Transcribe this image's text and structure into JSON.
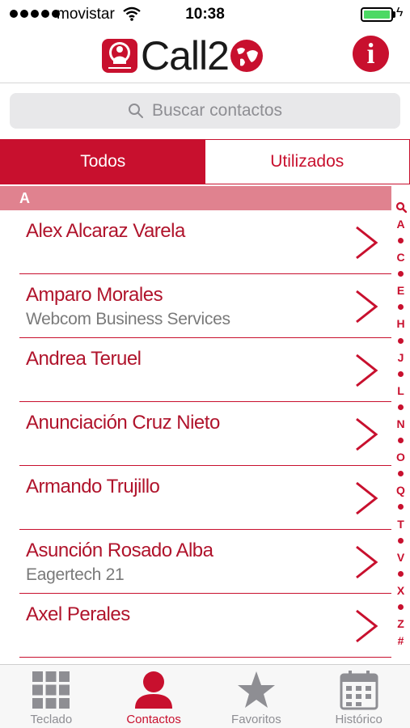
{
  "status_bar": {
    "carrier": "movistar",
    "time": "10:38",
    "battery_level": 1.0
  },
  "header": {
    "logo_text": "Call2",
    "info_label": "i"
  },
  "search": {
    "placeholder": "Buscar contactos"
  },
  "tabs": [
    {
      "label": "Todos",
      "active": true
    },
    {
      "label": "Utilizados",
      "active": false
    }
  ],
  "section": {
    "letter": "A"
  },
  "contacts": [
    {
      "name": "Alex Alcaraz Varela",
      "company": ""
    },
    {
      "name": "Amparo Morales",
      "company": "Webcom Business Services"
    },
    {
      "name": "Andrea Teruel",
      "company": ""
    },
    {
      "name": "Anunciación Cruz Nieto",
      "company": ""
    },
    {
      "name": "Armando Trujillo",
      "company": ""
    },
    {
      "name": "Asunción Rosado Alba",
      "company": "Eagertech 21"
    },
    {
      "name": "Axel Perales",
      "company": ""
    }
  ],
  "alpha_index": [
    "search",
    "A",
    "•",
    "C",
    "•",
    "E",
    "•",
    "H",
    "•",
    "J",
    "•",
    "L",
    "•",
    "N",
    "•",
    "O",
    "•",
    "Q",
    "•",
    "T",
    "•",
    "V",
    "•",
    "X",
    "•",
    "Z",
    "#"
  ],
  "tab_bar": [
    {
      "label": "Teclado",
      "icon": "keypad-icon",
      "active": false
    },
    {
      "label": "Contactos",
      "icon": "person-icon",
      "active": true
    },
    {
      "label": "Favoritos",
      "icon": "star-icon",
      "active": false
    },
    {
      "label": "Histórico",
      "icon": "calendar-icon",
      "active": false
    }
  ],
  "colors": {
    "accent": "#c8102e",
    "section_header": "#e0828f",
    "battery": "#4cd964"
  }
}
